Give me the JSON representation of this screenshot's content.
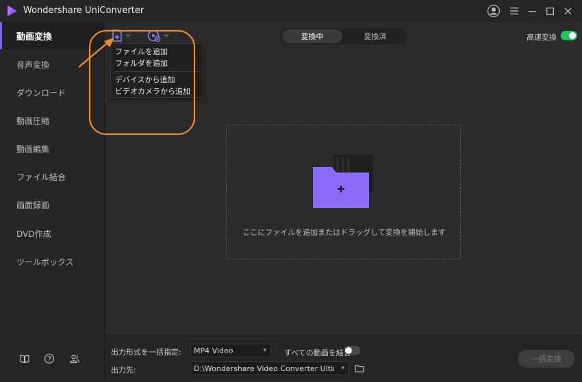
{
  "app": {
    "title": "Wondershare UniConverter"
  },
  "sidebar": {
    "items": [
      {
        "label": "動画変換"
      },
      {
        "label": "音声変換"
      },
      {
        "label": "ダウンロード"
      },
      {
        "label": "動画圧縮"
      },
      {
        "label": "動画編集"
      },
      {
        "label": "ファイル結合"
      },
      {
        "label": "画面録画"
      },
      {
        "label": "DVD作成"
      },
      {
        "label": "ツールボックス"
      }
    ],
    "active_index": 0
  },
  "toolbar": {
    "tabs": [
      {
        "label": "変換中"
      },
      {
        "label": "変換済"
      }
    ],
    "speed_label": "高速変換",
    "speed_enabled": true
  },
  "add_menu": {
    "items": [
      {
        "label": "ファイルを追加"
      },
      {
        "label": "フォルダを追加"
      },
      {
        "label": "デバイスから追加"
      },
      {
        "label": "ビデオカメラから追加"
      }
    ]
  },
  "dropzone": {
    "hint": "ここにファイルを追加またはドラッグして変換を開始します"
  },
  "bottom": {
    "format_label": "出力形式を一括指定:",
    "format_value": "MP4 Video",
    "merge_label": "すべての動画を結合",
    "merge_enabled": false,
    "output_label": "出力先:",
    "output_value": "D:\\Wondershare Video Converter Ultimate\\Co",
    "convert_all_label": "一括変換"
  },
  "colors": {
    "accent": "#7a5cf0",
    "toggle_on": "#21c55d",
    "annotation": "#f0892a"
  },
  "icons": {
    "logo": "uniconverter-logo",
    "add_file": "add-file-icon",
    "add_disc": "add-disc-icon",
    "account": "account-icon",
    "folder": "folder-add-icon"
  }
}
